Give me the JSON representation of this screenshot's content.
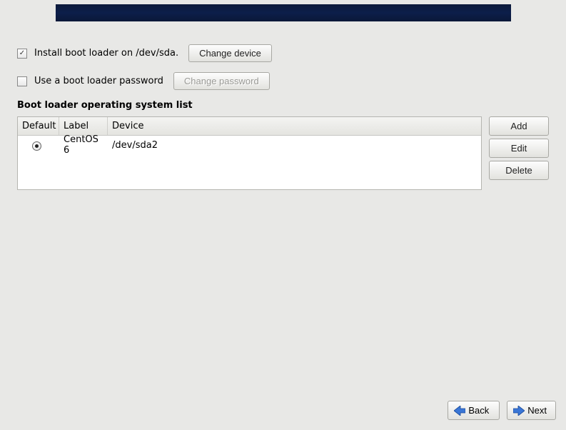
{
  "bootloader": {
    "install_label_prefix": "Install boot loader on ",
    "install_device": "/dev/sda.",
    "change_device_label": "Change device",
    "use_password_label": "Use a boot loader password",
    "change_password_label": "Change password",
    "install_checked": true,
    "use_password_checked": false
  },
  "os_list": {
    "title": "Boot loader operating system list",
    "headers": {
      "default": "Default",
      "label": "Label",
      "device": "Device"
    },
    "rows": [
      {
        "default": true,
        "label": "CentOS 6",
        "device": "/dev/sda2"
      }
    ]
  },
  "side": {
    "add": "Add",
    "edit": "Edit",
    "delete": "Delete"
  },
  "nav": {
    "back": "Back",
    "next": "Next"
  }
}
